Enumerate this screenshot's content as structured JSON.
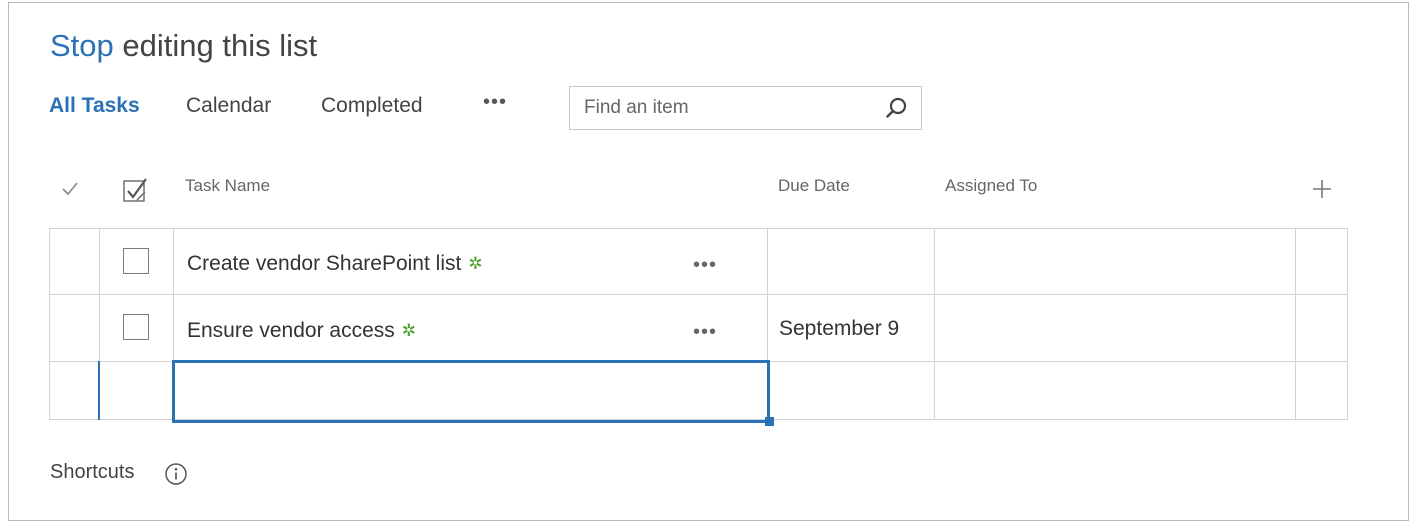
{
  "header": {
    "title_link": "Stop",
    "title_rest": "editing this list"
  },
  "views": {
    "items": [
      "All Tasks",
      "Calendar",
      "Completed"
    ],
    "more": "•••"
  },
  "search": {
    "placeholder": "Find an item",
    "icon": "search-icon"
  },
  "columns": {
    "task_name": "Task Name",
    "due_date": "Due Date",
    "assigned_to": "Assigned To"
  },
  "rows": [
    {
      "task": "Create vendor SharePoint list",
      "new_marker": "✲",
      "ellipsis": "•••",
      "due": "",
      "assigned": ""
    },
    {
      "task": "Ensure vendor access",
      "new_marker": "✲",
      "ellipsis": "•••",
      "due": "September 9",
      "assigned": ""
    }
  ],
  "footer": {
    "shortcuts_label": "Shortcuts",
    "info_icon": "info-icon"
  },
  "colors": {
    "accent": "#2a72b5",
    "new_marker": "#4a9e2a",
    "grid": "#d4d4d4"
  }
}
